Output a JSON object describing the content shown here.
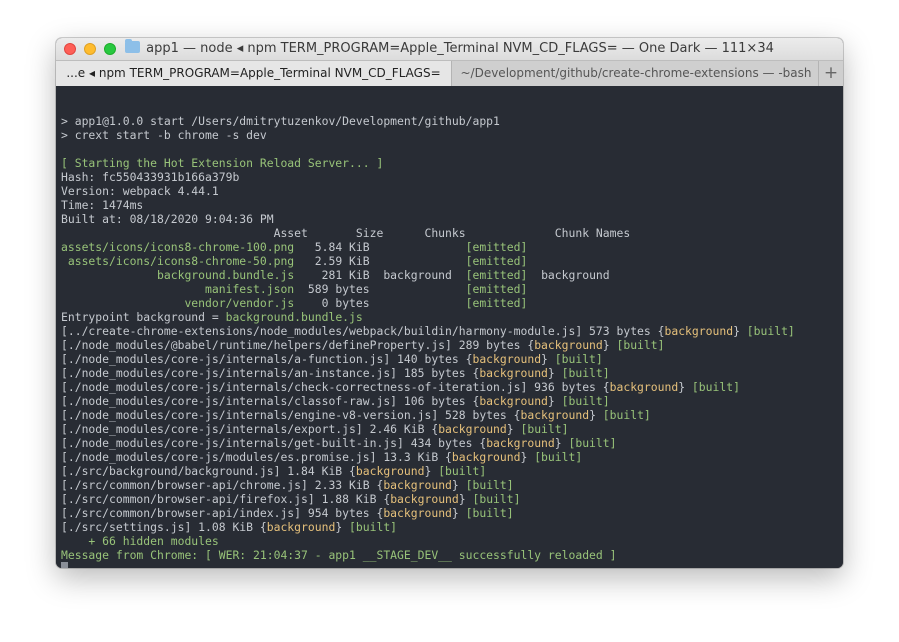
{
  "window": {
    "title": "app1 — node ◂ npm TERM_PROGRAM=Apple_Terminal NVM_CD_FLAGS= — One Dark — 111×34",
    "tabs": [
      {
        "label": "...e ◂ npm TERM_PROGRAM=Apple_Terminal NVM_CD_FLAGS="
      },
      {
        "label": "~/Development/github/create-chrome-extensions — -bash"
      }
    ],
    "add_tab_label": "+"
  },
  "colors": {
    "background": "#282c34",
    "text": "#c5c9cf",
    "green": "#98c379",
    "orange": "#e5c07b"
  },
  "terminal": {
    "lines": [
      "",
      "> app1@1.0.0 start /Users/dmitrytuzenkov/Development/github/app1",
      "> crext start -b chrome -s dev",
      "",
      "[ Starting the Hot Extension Reload Server... ]",
      "Hash: fc550433931b166a379b",
      "Version: webpack 4.44.1",
      "Time: 1474ms",
      "Built at: 08/18/2020 9:04:36 PM",
      "                               Asset       Size      Chunks             Chunk Names",
      "assets/icons/icons8-chrome-100.png   5.84 KiB              [emitted]",
      " assets/icons/icons8-chrome-50.png   2.59 KiB              [emitted]",
      "              background.bundle.js    281 KiB  background  [emitted]  background",
      "                     manifest.json  589 bytes              [emitted]",
      "                  vendor/vendor.js    0 bytes              [emitted]",
      "Entrypoint background = background.bundle.js",
      "[../create-chrome-extensions/node_modules/webpack/buildin/harmony-module.js] 573 bytes {background} [built]",
      "[./node_modules/@babel/runtime/helpers/defineProperty.js] 289 bytes {background} [built]",
      "[./node_modules/core-js/internals/a-function.js] 140 bytes {background} [built]",
      "[./node_modules/core-js/internals/an-instance.js] 185 bytes {background} [built]",
      "[./node_modules/core-js/internals/check-correctness-of-iteration.js] 936 bytes {background} [built]",
      "[./node_modules/core-js/internals/classof-raw.js] 106 bytes {background} [built]",
      "[./node_modules/core-js/internals/engine-v8-version.js] 528 bytes {background} [built]",
      "[./node_modules/core-js/internals/export.js] 2.46 KiB {background} [built]",
      "[./node_modules/core-js/internals/get-built-in.js] 434 bytes {background} [built]",
      "[./node_modules/core-js/modules/es.promise.js] 13.3 KiB {background} [built]",
      "[./src/background/background.js] 1.84 KiB {background} [built]",
      "[./src/common/browser-api/chrome.js] 2.33 KiB {background} [built]",
      "[./src/common/browser-api/firefox.js] 1.88 KiB {background} [built]",
      "[./src/common/browser-api/index.js] 954 bytes {background} [built]",
      "[./src/settings.js] 1.08 KiB {background} [built]",
      "    + 66 hidden modules",
      "Message from Chrome: [ WER: 21:04:37 - app1 __STAGE_DEV__ successfully reloaded ]"
    ]
  }
}
